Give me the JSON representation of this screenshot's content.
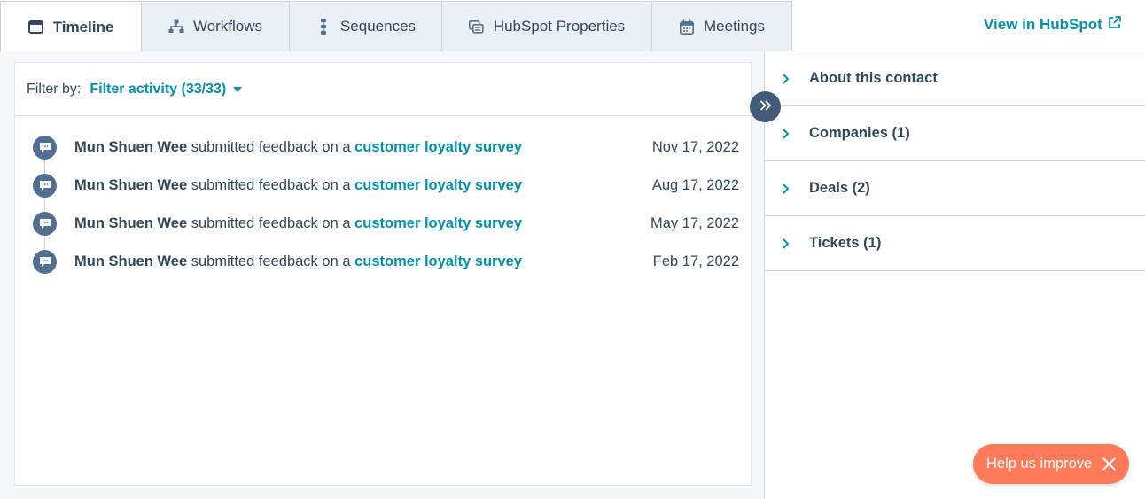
{
  "tabs": [
    {
      "label": "Timeline",
      "icon": "timeline-icon",
      "active": true
    },
    {
      "label": "Workflows",
      "icon": "workflow-icon",
      "active": false
    },
    {
      "label": "Sequences",
      "icon": "sequence-icon",
      "active": false
    },
    {
      "label": "HubSpot Properties",
      "icon": "properties-icon",
      "active": false
    },
    {
      "label": "Meetings",
      "icon": "calendar-icon",
      "active": false
    }
  ],
  "view_in_hubspot": "View in HubSpot",
  "filter": {
    "label": "Filter by:",
    "value": "Filter activity (33/33)"
  },
  "events": [
    {
      "who": "Mun Shuen Wee",
      "action": "submitted feedback on a",
      "link": "customer loyalty survey",
      "date": "Nov 17, 2022"
    },
    {
      "who": "Mun Shuen Wee",
      "action": "submitted feedback on a",
      "link": "customer loyalty survey",
      "date": "Aug 17, 2022"
    },
    {
      "who": "Mun Shuen Wee",
      "action": "submitted feedback on a",
      "link": "customer loyalty survey",
      "date": "May 17, 2022"
    },
    {
      "who": "Mun Shuen Wee",
      "action": "submitted feedback on a",
      "link": "customer loyalty survey",
      "date": "Feb 17, 2022"
    }
  ],
  "sections": [
    {
      "label": "About this contact"
    },
    {
      "label": "Companies (1)"
    },
    {
      "label": "Deals (2)"
    },
    {
      "label": "Tickets (1)"
    }
  ],
  "help": {
    "label": "Help us improve"
  },
  "colors": {
    "accent": "#0091ae",
    "help": "#ff7a59",
    "icon_bg": "#516f90",
    "tab_inactive": "#eaf0f6"
  }
}
